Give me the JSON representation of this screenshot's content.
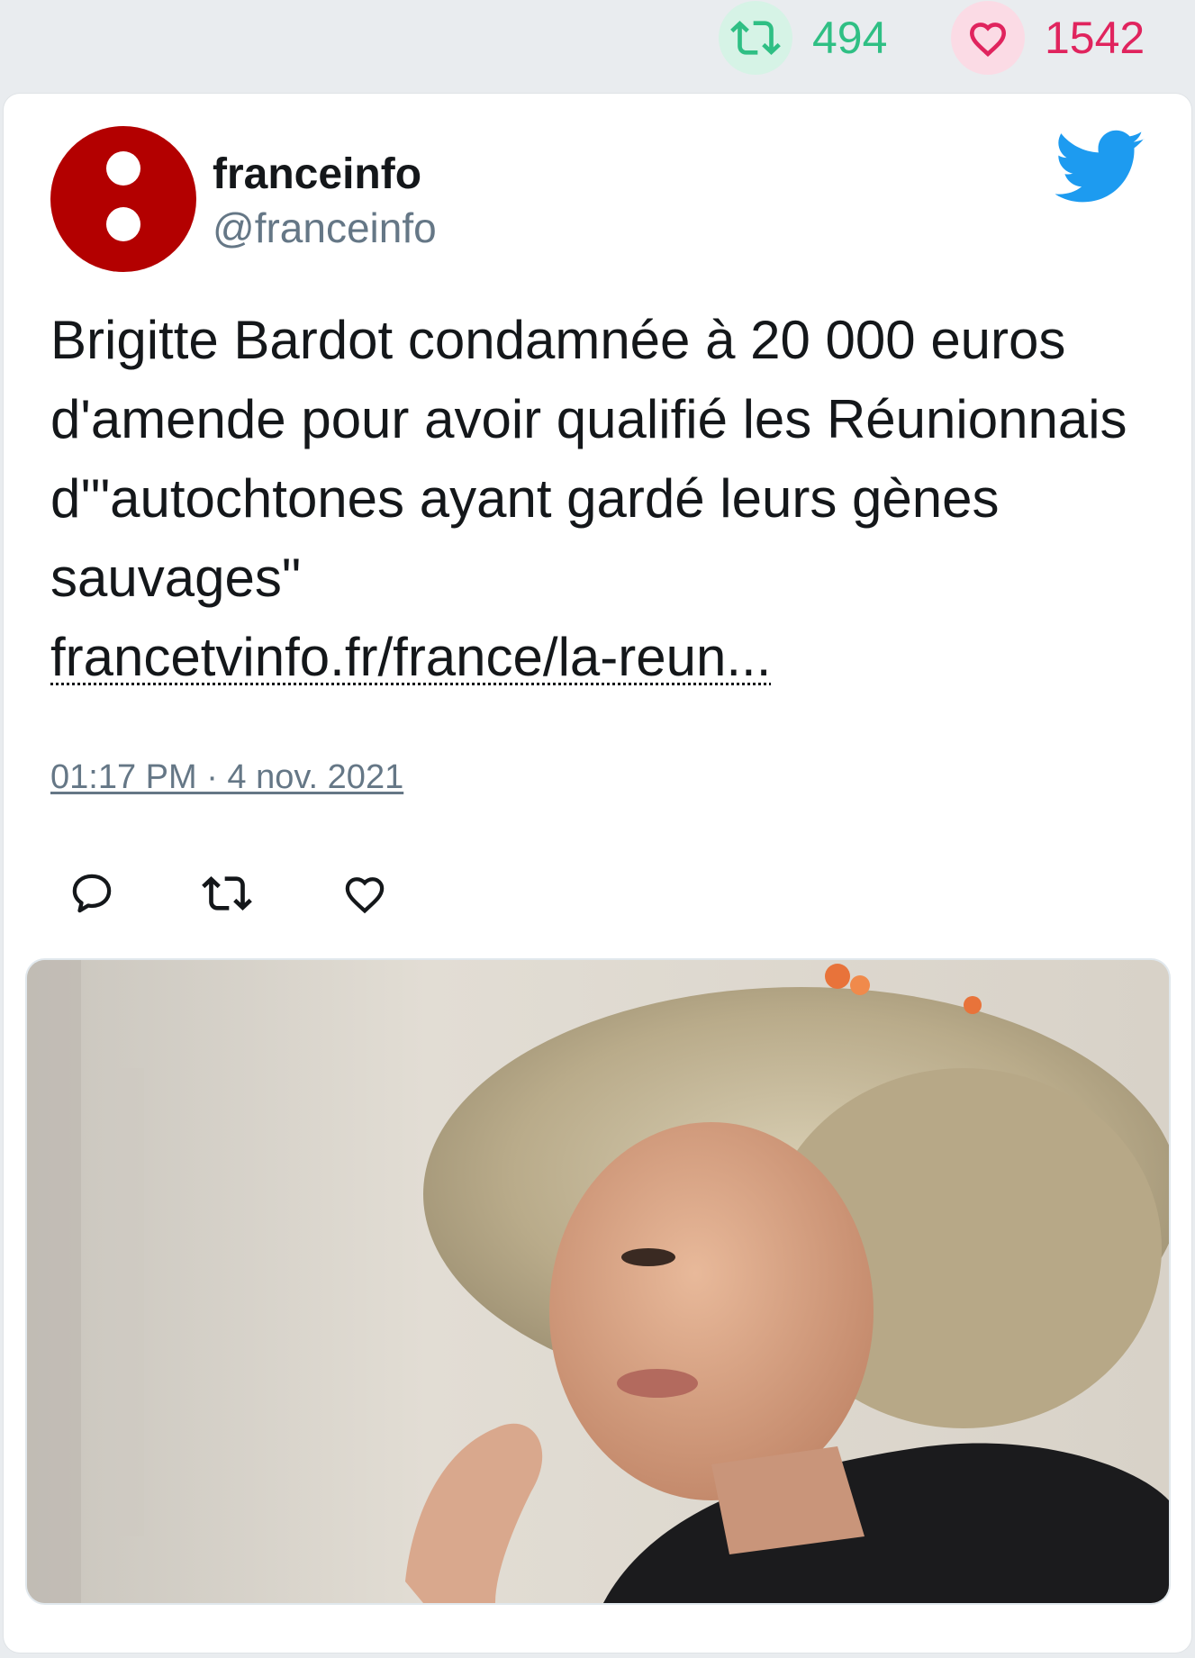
{
  "stats": {
    "retweets": "494",
    "likes": "1542",
    "retweet_icon": "retweet-icon",
    "like_icon": "heart-icon",
    "retweet_color": "#2fbf84",
    "like_color": "#e0245e"
  },
  "tweet": {
    "author_name": "franceinfo",
    "author_handle": "@franceinfo",
    "avatar_color": "#b30000",
    "platform_icon": "twitter-bird-icon",
    "platform_color": "#1d9bf0",
    "text": "Brigitte Bardot condamnée à 20 000 euros d'amende pour avoir qualifié les Réunionnais d'\"autochtones ayant gardé leurs gènes sauvages\"",
    "link": "francetvinfo.fr/france/la-reun...",
    "timestamp": "01:17 PM · 4 nov. 2021",
    "actions": [
      "reply-icon",
      "retweet-icon",
      "like-icon"
    ]
  }
}
